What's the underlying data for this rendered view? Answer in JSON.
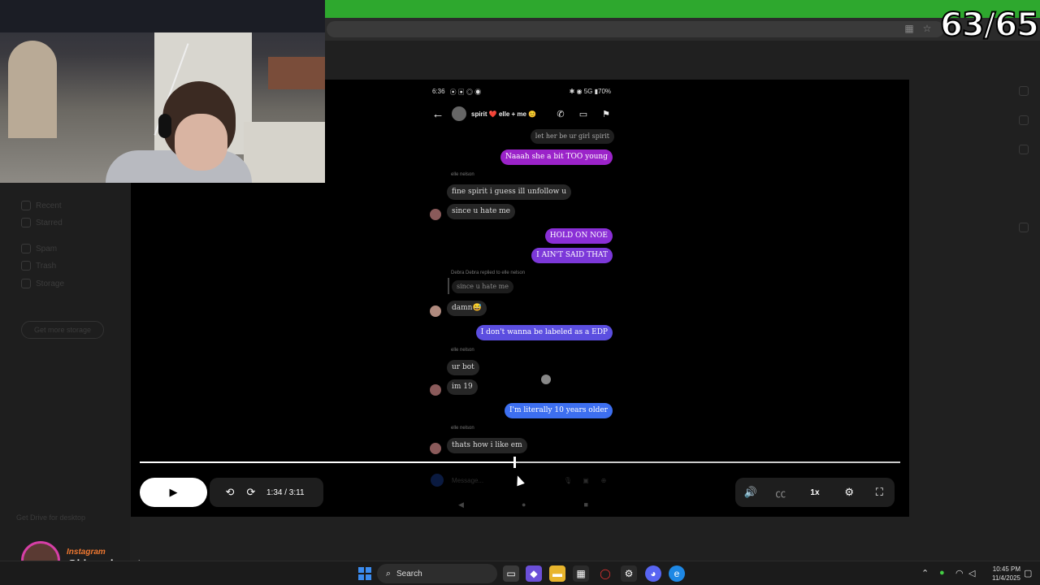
{
  "score_counter": "63/65",
  "phone": {
    "status_time": "6:36",
    "status_left_icons": "⦿ ▣ ◎ ◉",
    "status_right": "✱ ◉ 5G ▮70%",
    "chat_title": "spirit ❤️ elle + me 😊"
  },
  "messages": [
    {
      "kind": "sent",
      "text": "let her be ur girl spirit",
      "color": "#2a2a2a"
    },
    {
      "kind": "sent",
      "text": "Naaah she a bit TOO young",
      "color": "#9b23c9"
    },
    {
      "kind": "sender",
      "text": "elle nelson"
    },
    {
      "kind": "recv",
      "text": "fine spirit i guess ill unfollow u"
    },
    {
      "kind": "recv",
      "text": "since u hate me"
    },
    {
      "kind": "sent",
      "text": "HOLD ON NOE",
      "color": "#8a2fd6"
    },
    {
      "kind": "sent",
      "text": "I AIN'T SAID THAT",
      "color": "#7c38d9"
    },
    {
      "kind": "reply_note",
      "text": "Debra Debra replied to elle nelson"
    },
    {
      "kind": "quote",
      "text": "since u hate me"
    },
    {
      "kind": "recv",
      "text": "damn😅"
    },
    {
      "kind": "sent",
      "text": "I don't wanna be labeled as a EDP",
      "color": "#5b4ee0"
    },
    {
      "kind": "sender",
      "text": "elle nelson"
    },
    {
      "kind": "recv",
      "text": "ur bot"
    },
    {
      "kind": "recv",
      "text": "im 19"
    },
    {
      "kind": "sent",
      "text": "I'm literally 10 years older",
      "color": "#3d6ff0"
    },
    {
      "kind": "sender",
      "text": "elle nelson"
    },
    {
      "kind": "recv",
      "text": "thats how i like em"
    }
  ],
  "composer_placeholder": "Message...",
  "player": {
    "progress_fraction": 0.4921,
    "time": "1:34 / 3:11",
    "speed": "1x",
    "play_icon": "▶",
    "rewind_icon": "⟲",
    "forward_icon": "⟳",
    "volume_icon": "🔊",
    "cc_icon": "㏄",
    "settings_icon": "⚙",
    "fullscreen_icon": "⛶"
  },
  "instagram": {
    "label": "Instagram",
    "handle": "@bigsackwontsag"
  },
  "taskbar": {
    "search_label": "Search",
    "clock_time": "10:45 PM",
    "clock_date": "11/4/2025"
  },
  "background_sidebar": [
    "Recent",
    "Starred",
    "Spam",
    "Trash",
    "Storage"
  ],
  "background_button": "Get more storage",
  "background_footer": "Get Drive for desktop"
}
